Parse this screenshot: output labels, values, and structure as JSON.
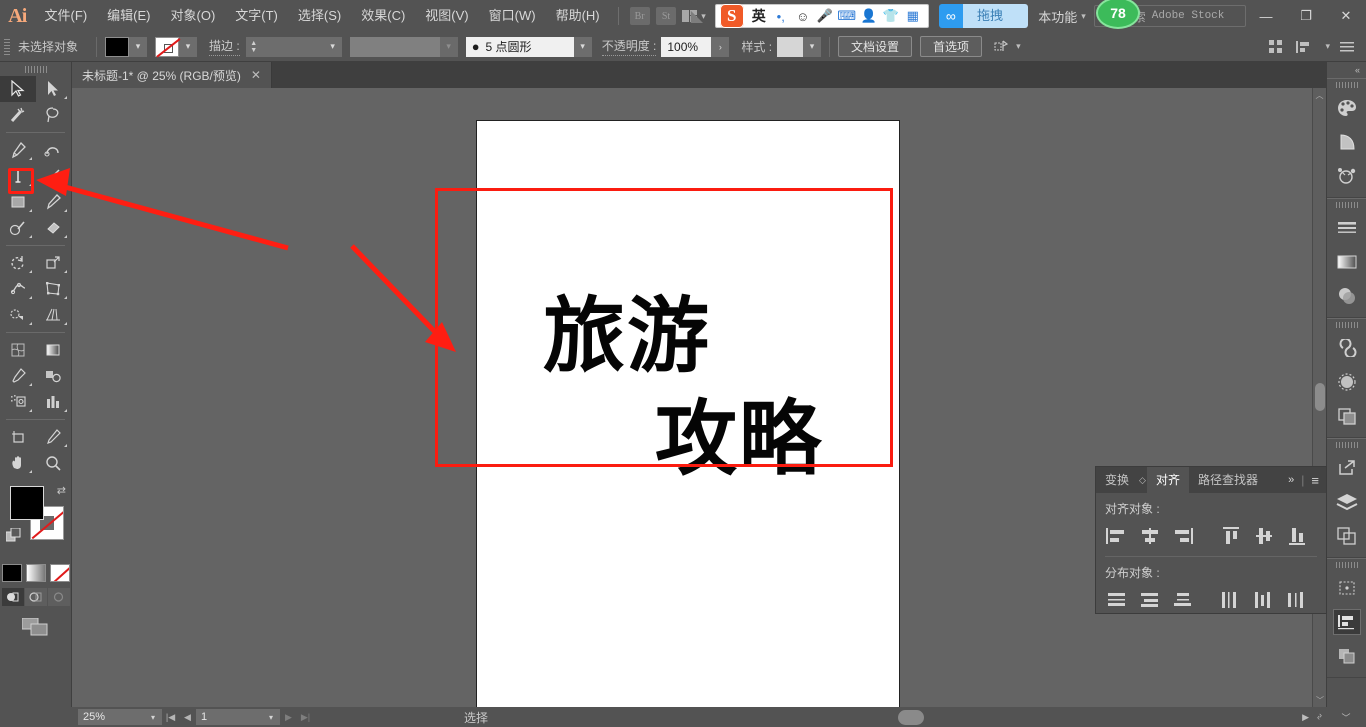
{
  "app": {
    "name": "Adobe Illustrator",
    "logo": "Ai"
  },
  "menubar": {
    "items": [
      {
        "label": "文件(F)",
        "name": "menu-file"
      },
      {
        "label": "编辑(E)",
        "name": "menu-edit"
      },
      {
        "label": "对象(O)",
        "name": "menu-object"
      },
      {
        "label": "文字(T)",
        "name": "menu-type"
      },
      {
        "label": "选择(S)",
        "name": "menu-select"
      },
      {
        "label": "效果(C)",
        "name": "menu-effect"
      },
      {
        "label": "视图(V)",
        "name": "menu-view"
      },
      {
        "label": "窗口(W)",
        "name": "menu-window"
      },
      {
        "label": "帮助(H)",
        "name": "menu-help"
      }
    ],
    "bridge_label": "Br",
    "stock_label": "St",
    "workspace_label": "本功能",
    "badge_count": "78",
    "search_label": "搜索",
    "search_placeholder": "Adobe Stock",
    "window_controls": {
      "minimize": "—",
      "restore": "❐",
      "close": "✕"
    }
  },
  "ime": {
    "logo": "S",
    "mode_label": "英",
    "punctuation": "•,",
    "items": [
      "emoji-icon",
      "microphone-icon",
      "keyboard-icon",
      "user-icon",
      "skin-icon",
      "apps-icon"
    ]
  },
  "upload": {
    "icon": "cloud-link-icon",
    "label": "拖拽上传"
  },
  "optionsbar": {
    "selection_status": "未选择对象",
    "fill_color": "#000000",
    "stroke_color": "none",
    "stroke_label": "描边 :",
    "stroke_weight": "",
    "brush_preset": "5 点圆形",
    "opacity_label": "不透明度 :",
    "opacity_value": "100%",
    "style_label": "样式 :",
    "doc_setup_button": "文档设置",
    "preferences_button": "首选项"
  },
  "tabs": {
    "documents": [
      {
        "title": "未标题-1* @ 25% (RGB/预览)",
        "close": "✕",
        "active": true
      }
    ]
  },
  "toolbar": {
    "tools_left": [
      {
        "name": "selection-tool",
        "glyph": "selection",
        "active": true
      },
      {
        "name": "magic-wand-tool",
        "glyph": "wand"
      },
      {
        "name": "pen-tool",
        "glyph": "pen",
        "submenu": true
      },
      {
        "name": "type-tool",
        "glyph": "type",
        "submenu": true,
        "highlighted": true
      },
      {
        "name": "rectangle-tool",
        "glyph": "rect",
        "submenu": true
      },
      {
        "name": "shaper-tool",
        "glyph": "shaper",
        "submenu": true
      },
      {
        "name": "rotate-tool",
        "glyph": "rotate",
        "submenu": true
      },
      {
        "name": "width-tool",
        "glyph": "width",
        "submenu": true
      },
      {
        "name": "shape-builder-tool",
        "glyph": "shapebuilder",
        "submenu": true
      },
      {
        "name": "perspective-grid-tool",
        "glyph": "perspective",
        "submenu": true
      },
      {
        "name": "eyedropper-tool",
        "glyph": "eyedropper",
        "submenu": true
      },
      {
        "name": "symbol-sprayer-tool",
        "glyph": "symbol",
        "submenu": true
      },
      {
        "name": "artboard-tool",
        "glyph": "artboard"
      },
      {
        "name": "hand-tool",
        "glyph": "hand",
        "submenu": true
      }
    ],
    "tools_right": [
      {
        "name": "direct-selection-tool",
        "glyph": "directsel",
        "submenu": true
      },
      {
        "name": "lasso-tool",
        "glyph": "lasso"
      },
      {
        "name": "curvature-tool",
        "glyph": "curvature"
      },
      {
        "name": "line-segment-tool",
        "glyph": "line",
        "submenu": true
      },
      {
        "name": "paintbrush-tool",
        "glyph": "brush",
        "submenu": true
      },
      {
        "name": "eraser-tool",
        "glyph": "eraser",
        "submenu": true
      },
      {
        "name": "scale-tool",
        "glyph": "scale",
        "submenu": true
      },
      {
        "name": "free-transform-tool",
        "glyph": "freetransform"
      },
      {
        "name": "gradient-tool",
        "glyph": "gradient"
      },
      {
        "name": "blend-tool",
        "glyph": "blend",
        "submenu": true
      },
      {
        "name": "column-graph-tool",
        "glyph": "graph",
        "submenu": true
      },
      {
        "name": "slice-tool",
        "glyph": "slice",
        "submenu": true
      },
      {
        "name": "zoom-tool",
        "glyph": "zoom"
      }
    ],
    "fill_color": "#000000",
    "stroke_color": "#ffffff",
    "swap_icon": "swap-fill-stroke-icon",
    "default_icon": "default-fill-stroke-icon",
    "mini_swatches": [
      "solid-color",
      "gradient",
      "none"
    ],
    "draw_modes": [
      "draw-normal",
      "draw-behind",
      "draw-inside"
    ],
    "screen_mode_icon": "screen-mode-icon"
  },
  "canvas": {
    "artboard": {
      "background": "#ffffff",
      "text_lines": [
        {
          "text": "旅游",
          "name": "artboard-text-line-1"
        },
        {
          "text": "攻略",
          "name": "artboard-text-line-2"
        }
      ]
    },
    "annotations": {
      "rect_color": "#fb1c10",
      "arrow_color": "#ff1e12",
      "arrow_1_name": "annotation-arrow-to-type-tool",
      "arrow_2_name": "annotation-arrow-to-canvas",
      "rect_name": "annotation-rect-around-text",
      "type_tool_highlight_name": "annotation-rect-type-tool"
    }
  },
  "align_panel": {
    "tabs": [
      {
        "label": "变换",
        "active": false,
        "name": "tab-transform"
      },
      {
        "label": "对齐",
        "active": true,
        "name": "tab-align"
      },
      {
        "label": "路径查找器",
        "active": false,
        "name": "tab-pathfinder"
      }
    ],
    "overflow_icon": "»",
    "menu_icon": "≡",
    "align_objects_label": "对齐对象 :",
    "distribute_objects_label": "分布对象 :",
    "align_buttons": [
      "align-left-edge",
      "align-horizontal-center",
      "align-right-edge",
      "align-top-edge",
      "align-vertical-center",
      "align-bottom-edge"
    ],
    "distribute_buttons": [
      "distribute-top-edge",
      "distribute-vertical-center",
      "distribute-bottom-edge",
      "distribute-left-edge",
      "distribute-horizontal-center",
      "distribute-right-edge"
    ]
  },
  "right_dock": {
    "collapse_icon": "«",
    "groups": [
      {
        "icons": [
          "color-palette-icon",
          "color-guide-icon",
          "symbols-icon"
        ]
      },
      {
        "icons": [
          "stroke-icon",
          "gradient-icon",
          "transparency-icon"
        ]
      },
      {
        "icons": [
          "creative-cloud-libraries-icon",
          "brushes-icon",
          "graphic-styles-icon"
        ]
      },
      {
        "icons": [
          "export-icon",
          "layers-icon",
          "artboards-icon"
        ]
      },
      {
        "icons": [
          "transform-icon",
          "align-icon",
          "pathfinder-icon"
        ]
      }
    ],
    "active_icon": "align-icon"
  },
  "statusbar": {
    "zoom_level": "25%",
    "page_number": "1",
    "status_text": "选择",
    "first_icon": "first-artboard-icon",
    "prev_icon": "prev-artboard-icon",
    "next_icon": "next-artboard-icon",
    "last_icon": "last-artboard-icon"
  }
}
